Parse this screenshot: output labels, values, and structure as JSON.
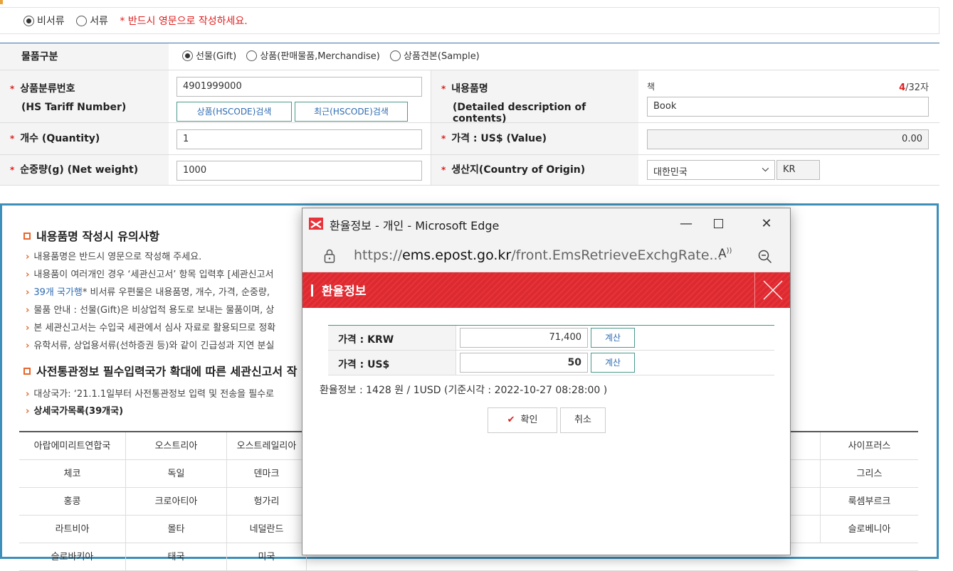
{
  "doc_type": {
    "options": [
      "비서류",
      "서류"
    ],
    "selected": 0,
    "notice": "* 반드시 영문으로 작성하세요."
  },
  "form": {
    "category": {
      "label": "물품구분",
      "options": [
        "선물(Gift)",
        "상품(판매물품,Merchandise)",
        "상품견본(Sample)"
      ],
      "selected": 0
    },
    "hs": {
      "label": "상품분류번호",
      "sublabel": "(HS Tariff Number)",
      "value": "4901999000",
      "btn_search": "상품(HSCODE)검색",
      "btn_recent": "최근(HSCODE)검색"
    },
    "contents": {
      "label": "내용품명",
      "sublabel": "(Detailed description of contents)",
      "korean": "책",
      "count": "4",
      "count_max": "/32자",
      "value": "Book"
    },
    "quantity": {
      "label": "개수 (Quantity)",
      "value": "1"
    },
    "price": {
      "label": "가격 : US$ (Value)",
      "value": "0.00"
    },
    "weight": {
      "label": "순중량(g) (Net weight)",
      "value": "1000"
    },
    "origin": {
      "label": "생산지(Country of Origin)",
      "country": "대한민국",
      "code": "KR"
    }
  },
  "notices": {
    "title1": "내용품명 작성시 유의사항",
    "bullets": [
      "내용품명은 반드시 영문으로 작성해 주세요.",
      "내용품이 여러개인 경우 ‘세관신고서’ 항목 입력후 [세관신고서",
      "39개 국가행* 비서류 우편물은 내용품명, 개수, 가격, 순중량,",
      "물품 안내 : 선물(Gift)은 비상업적 용도로 보내는 물품이며, 상",
      "본 세관신고서는 수입국 세관에서 심사 자료로 활용되므로 정확",
      "유학서류, 상업용서류(선하증권 등)와 같이 긴급성과 지연 분실"
    ],
    "bullet3_prefix": "39개 국가행",
    "bullet3_rest": "* 비서류 우편물은 내용품명, 개수, 가격, 순중량,",
    "title2": "사전통관정보 필수입력국가 확대에 따른 세관신고서 작",
    "sub_bullets": [
      "대상국가: ‘21.1.1일부터 사전통관정보 입력 및 전송을 필수로",
      "상세국가목록(39개국)"
    ]
  },
  "countries": [
    [
      "아랍에미리트연합국",
      "오스트리아",
      "오스트레일리아",
      "사이프러스"
    ],
    [
      "체코",
      "독일",
      "덴마크",
      "그리스"
    ],
    [
      "홍콩",
      "크로아티아",
      "헝가리",
      "룩셈부르크"
    ],
    [
      "라트비아",
      "몰타",
      "네덜란드",
      "슬로베니아"
    ],
    [
      "슬로바키아",
      "태국",
      "미국",
      ""
    ]
  ],
  "popup": {
    "window_title": "환율정보 - 개인 - Microsoft Edge",
    "url_prefix": "https://",
    "url_domain": "ems.epost.go.kr",
    "url_path": "/front.EmsRetrieveExchgRate...",
    "banner_title": "환율정보",
    "krw_label": "가격 : KRW",
    "krw_value": "71,400",
    "usd_label": "가격 : US$",
    "usd_value": "50",
    "calc_label": "계산",
    "rate_info": "환율정보 : 1428 원 / 1USD (기준시각 : 2022-10-27 08:28:00 )",
    "ok_label": "확인",
    "cancel_label": "취소"
  }
}
